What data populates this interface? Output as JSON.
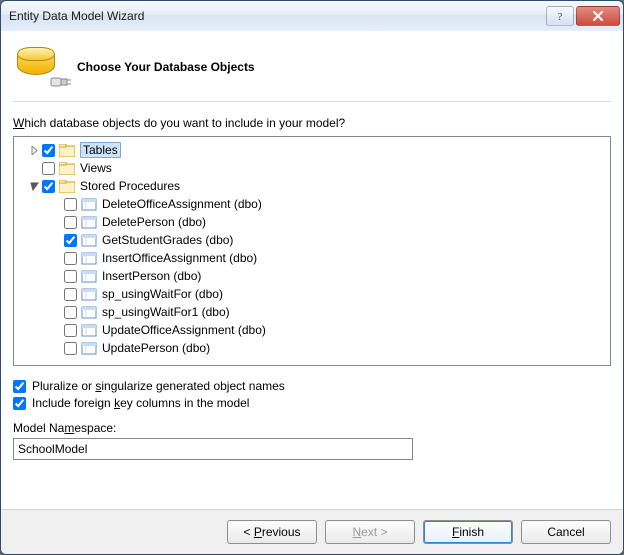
{
  "window": {
    "title": "Entity Data Model Wizard"
  },
  "header": {
    "title": "Choose Your Database Objects"
  },
  "prompt": {
    "pre": "W",
    "rest": "hich database objects do you want to include in your model?"
  },
  "tree": {
    "root": [
      {
        "label": "Tables",
        "checked": true,
        "expanded": false
      },
      {
        "label": "Views",
        "checked": false,
        "expanded": null
      },
      {
        "label": "Stored Procedures",
        "checked": true,
        "expanded": true
      }
    ],
    "procs": [
      {
        "label": "DeleteOfficeAssignment (dbo)",
        "checked": false
      },
      {
        "label": "DeletePerson (dbo)",
        "checked": false
      },
      {
        "label": "GetStudentGrades (dbo)",
        "checked": true
      },
      {
        "label": "InsertOfficeAssignment (dbo)",
        "checked": false
      },
      {
        "label": "InsertPerson (dbo)",
        "checked": false
      },
      {
        "label": "sp_usingWaitFor (dbo)",
        "checked": false
      },
      {
        "label": "sp_usingWaitFor1 (dbo)",
        "checked": false
      },
      {
        "label": "UpdateOfficeAssignment (dbo)",
        "checked": false
      },
      {
        "label": "UpdatePerson (dbo)",
        "checked": false
      }
    ]
  },
  "options": {
    "pluralize": {
      "pre": "Pluralize or ",
      "u": "s",
      "post": "ingularize generated object names",
      "checked": true
    },
    "fk": {
      "pre": "Include foreign ",
      "u": "k",
      "post": "ey columns in the model",
      "checked": true
    }
  },
  "ns": {
    "label_pre": "Model Na",
    "label_u": "m",
    "label_post": "espace:",
    "value": "SchoolModel"
  },
  "footer": {
    "previous_u": "P",
    "previous_post": "revious",
    "next_u": "N",
    "next_post": "ext >",
    "finish_u": "F",
    "finish_post": "inish",
    "cancel": "Cancel"
  }
}
